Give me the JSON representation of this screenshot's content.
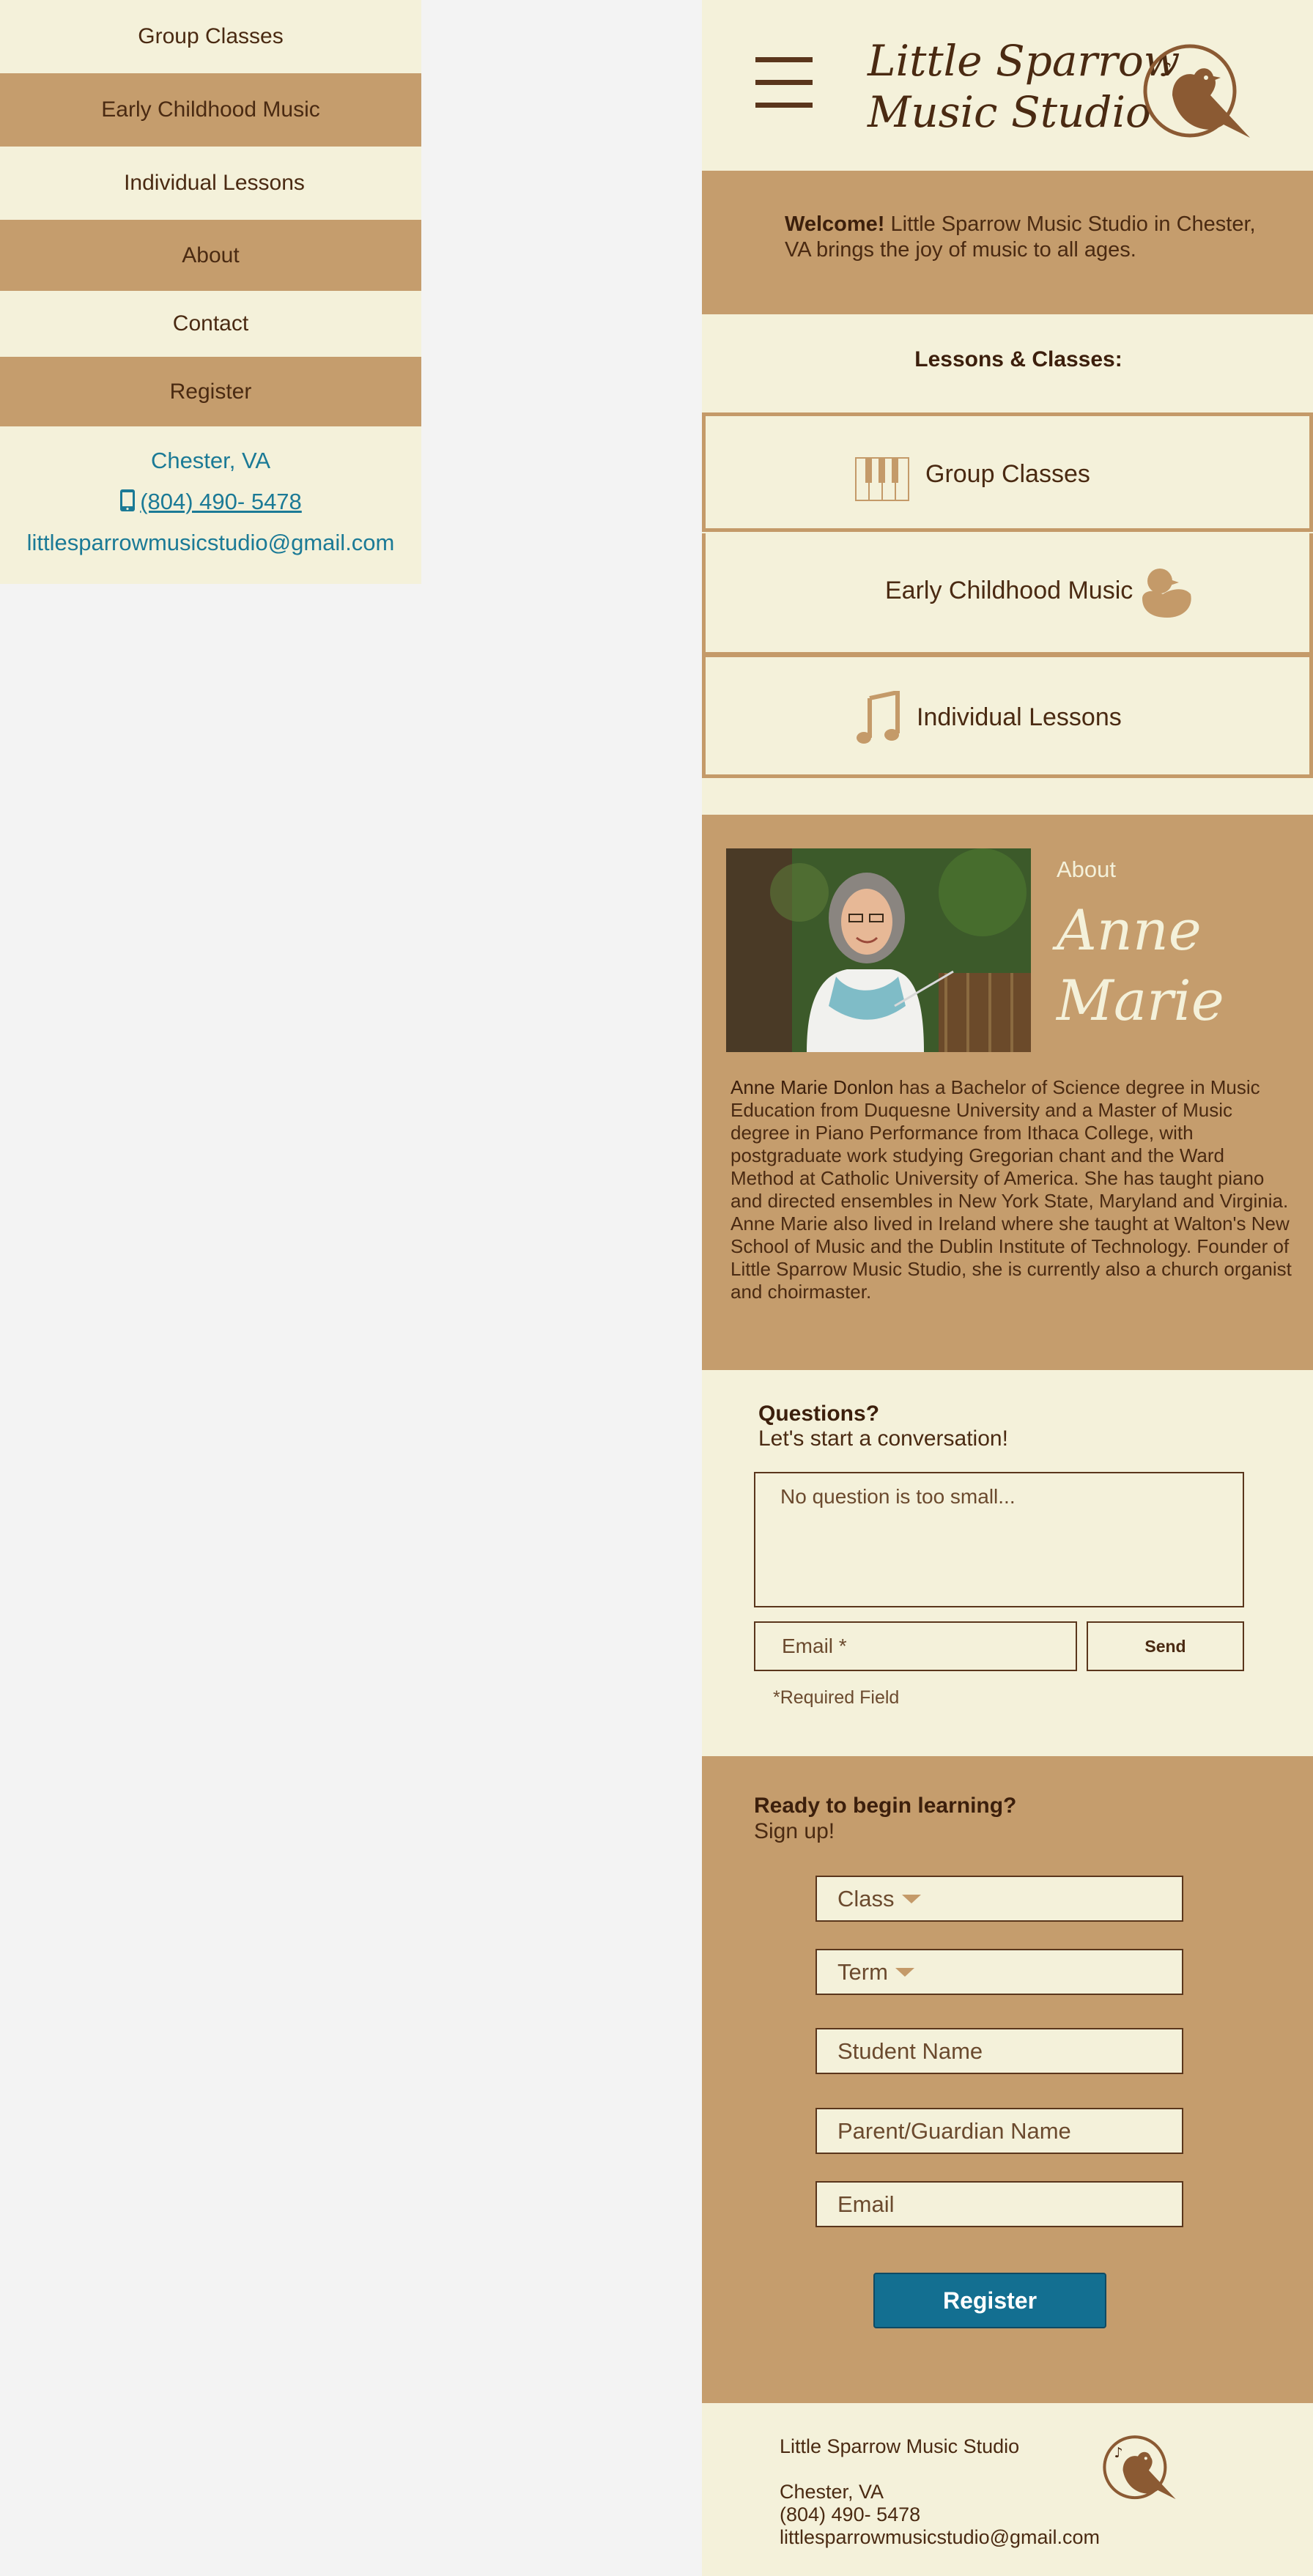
{
  "menu": {
    "items": [
      {
        "label": "Group Classes"
      },
      {
        "label": "Early Childhood Music"
      },
      {
        "label": "Individual Lessons"
      },
      {
        "label": "About"
      },
      {
        "label": "Contact"
      },
      {
        "label": "Register"
      }
    ],
    "location": "Chester, VA",
    "phone": "(804) 490- 5478",
    "email": "littlesparrowmusicstudio@gmail.com"
  },
  "header": {
    "logo_line1": "Little Sparrow",
    "logo_line2": "Music Studio",
    "icons": [
      "hamburger-icon",
      "sparrow-logo-icon"
    ]
  },
  "welcome": {
    "bold": "Welcome!",
    "text": "Little Sparrow Music Studio in Chester, VA brings the joy of music to all ages."
  },
  "lessons": {
    "heading": "Lessons & Classes:",
    "items": [
      {
        "label": "Group Classes",
        "icon": "piano-keys-icon"
      },
      {
        "label": "Early Childhood Music",
        "icon": "rubber-duck-icon"
      },
      {
        "label": "Individual Lessons",
        "icon": "music-notes-icon"
      }
    ]
  },
  "about": {
    "label": "About",
    "name_line1": "Anne",
    "name_line2": "Marie",
    "bio_name": "Anne Marie Donlon",
    "bio": "has a Bachelor of Science degree in Music Education from Duquesne University and a Master of Music degree in Piano Performance from Ithaca College, with postgraduate work studying Gregorian chant and the Ward Method at Catholic University of America. She has taught piano and directed ensembles in New York State, Maryland and Virginia. Anne Marie also lived in Ireland where she taught at Walton's New School of Music and the Dublin Institute of Technology. Founder of Little Sparrow Music Studio, she is currently also a church organist and choirmaster."
  },
  "questions": {
    "heading": "Questions?",
    "sub": "Let's start a conversation!",
    "message_placeholder": "No question is too small...",
    "email_placeholder": "Email *",
    "send_label": "Send",
    "required_note": "*Required Field"
  },
  "register": {
    "heading": "Ready to begin learning?",
    "sub": "Sign up!",
    "class_label": "Class",
    "term_label": "Term",
    "student_placeholder": "Student Name",
    "parent_placeholder": "Parent/Guardian Name",
    "email_placeholder": "Email",
    "button_label": "Register"
  },
  "footer": {
    "name": "Little Sparrow Music Studio",
    "location": "Chester, VA",
    "phone": "(804) 490- 5478",
    "email": "littlesparrowmusicstudio@gmail.com"
  },
  "colors": {
    "cream": "#f4f1da",
    "tan": "#c59d6d",
    "brown": "#5a361c",
    "link_blue": "#1b7a96",
    "button_blue": "#136f91"
  }
}
